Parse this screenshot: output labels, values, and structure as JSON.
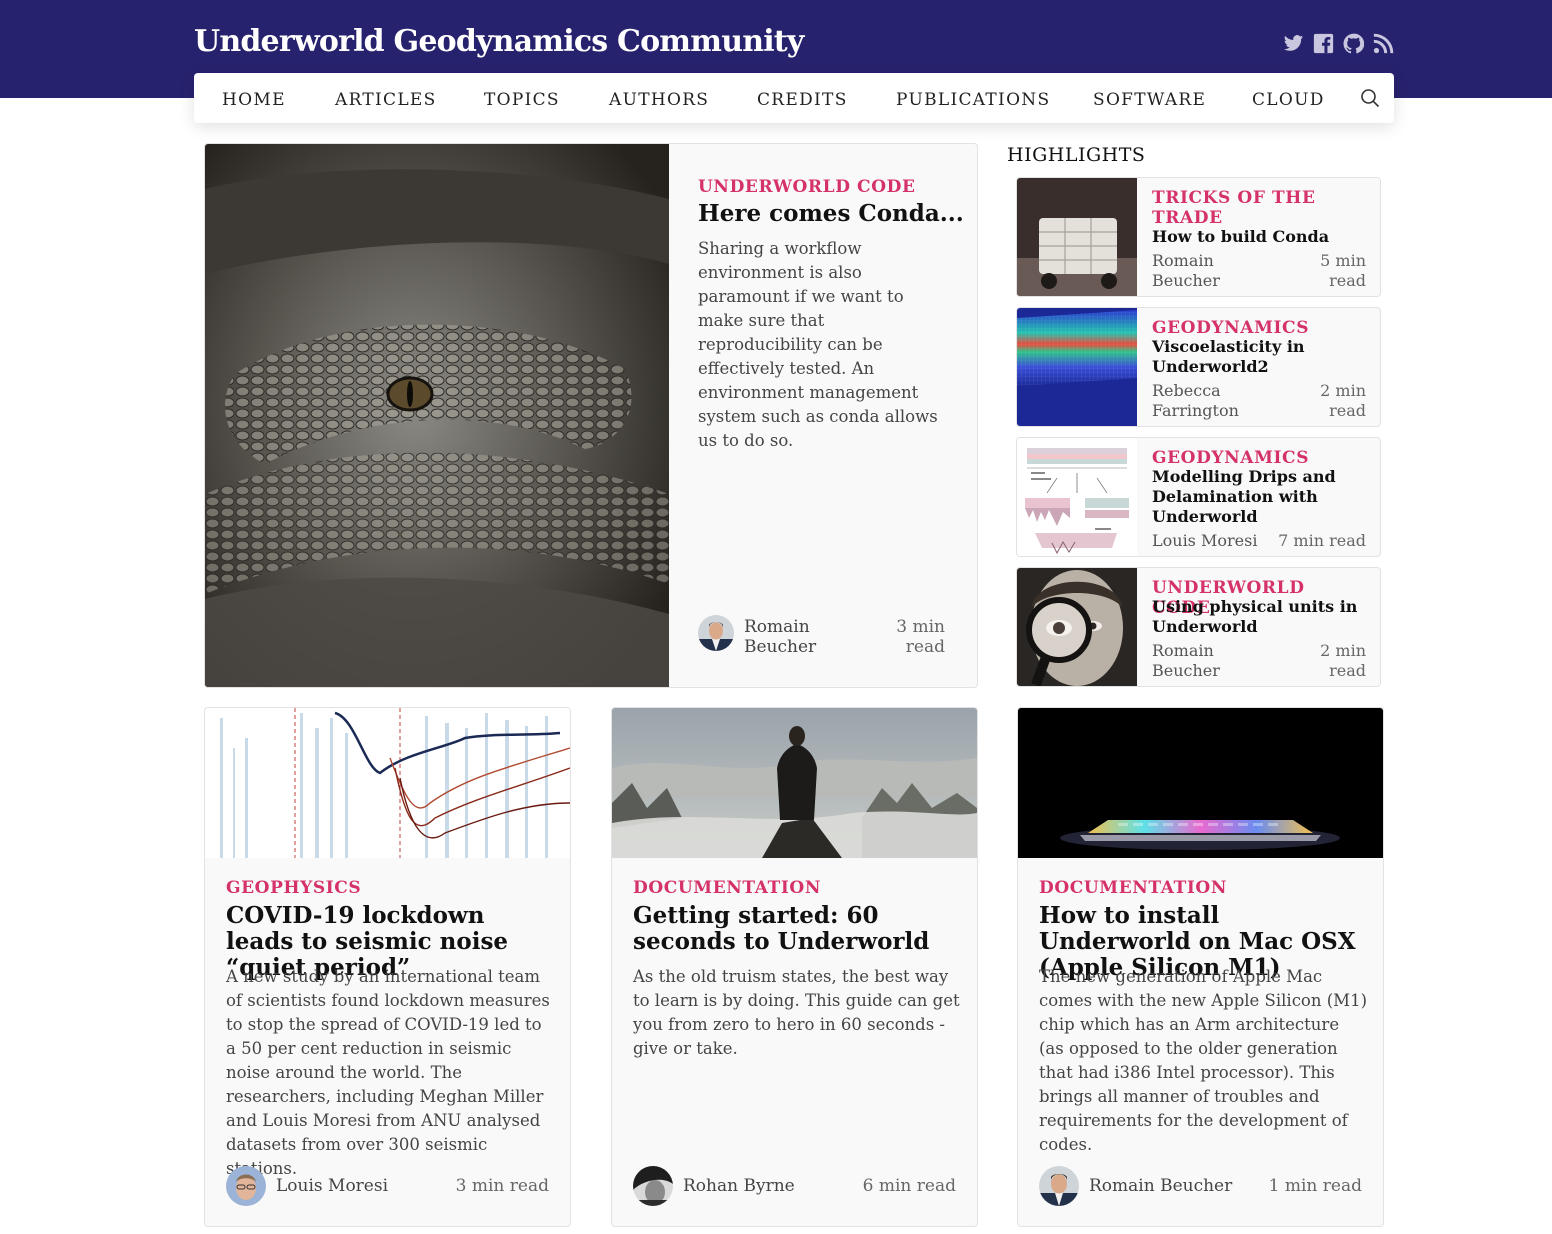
{
  "site": {
    "title": "Underworld Geodynamics Community"
  },
  "social": [
    "twitter-icon",
    "facebook-icon",
    "github-icon",
    "rss-icon"
  ],
  "nav": {
    "items": [
      "HOME",
      "ARTICLES",
      "TOPICS",
      "AUTHORS",
      "CREDITS",
      "PUBLICATIONS",
      "SOFTWARE",
      "CLOUD"
    ],
    "search_icon": "search-icon"
  },
  "featured": {
    "category": "UNDERWORLD CODE",
    "title": "Here comes Conda...",
    "excerpt": "Sharing a workflow environment is also paramount if we want to make sure that reproducibility can be effectively tested. An environment management system such as conda allows us to do so.",
    "author": "Romain Beucher",
    "read_time": "3 min read"
  },
  "highlights": {
    "heading": "HIGHLIGHTS",
    "items": [
      {
        "category": "TRICKS OF THE TRADE",
        "title": "How to build Conda",
        "author": "Romain Beucher",
        "read_time": "5 min read"
      },
      {
        "category": "GEODYNAMICS",
        "title": "Viscoelasticity in Underworld2",
        "author": "Rebecca Farrington",
        "read_time": "2 min read"
      },
      {
        "category": "GEODYNAMICS",
        "title": "Modelling Drips and Delamination with Underworld",
        "author": "Louis Moresi",
        "read_time": "7 min read"
      },
      {
        "category": "UNDERWORLD CODE",
        "title": "Using physical units in Underworld",
        "author": "Romain Beucher",
        "read_time": "2 min read"
      }
    ]
  },
  "cards": [
    {
      "category": "GEOPHYSICS",
      "title": "COVID-19 lockdown leads to seismic noise “quiet period”",
      "excerpt": "A new study by an international team of scientists found lockdown measures to stop the spread of COVID-19 led to a 50 per cent reduction in seismic noise around the world. The researchers, including Meghan Miller and Louis Moresi from ANU analysed datasets from over 300 seismic stations.",
      "author": "Louis Moresi",
      "read_time": "3 min read"
    },
    {
      "category": "DOCUMENTATION",
      "title": "Getting started: 60 seconds to Underworld",
      "excerpt": "As the old truism states, the best way to learn is by doing. This guide can get you from zero to hero in 60 seconds - give or take.",
      "author": "Rohan Byrne",
      "read_time": "6 min read"
    },
    {
      "category": "DOCUMENTATION",
      "title": "How to install Underworld on Mac OSX (Apple Silicon M1)",
      "excerpt": "The new generation of Apple Mac comes with the new Apple Silicon (M1) chip which has an Arm architecture (as opposed to the older generation that had i386 Intel processor). This brings all manner of troubles and requirements for the development of codes.",
      "author": "Romain Beucher",
      "read_time": "1 min read"
    }
  ]
}
